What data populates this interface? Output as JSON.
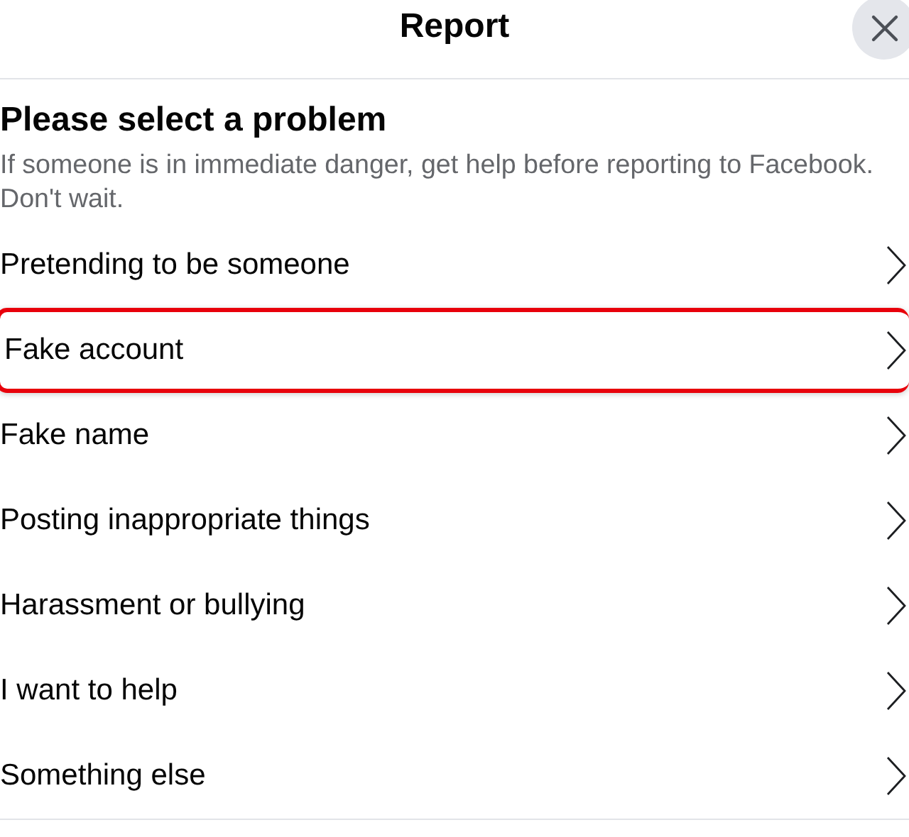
{
  "header": {
    "title": "Report"
  },
  "heading": "Please select a problem",
  "description": "If someone is in immediate danger, get help before reporting to Facebook. Don't wait.",
  "options": [
    {
      "label": "Pretending to be someone",
      "highlighted": false
    },
    {
      "label": "Fake account",
      "highlighted": true
    },
    {
      "label": "Fake name",
      "highlighted": false
    },
    {
      "label": "Posting inappropriate things",
      "highlighted": false
    },
    {
      "label": "Harassment or bullying",
      "highlighted": false
    },
    {
      "label": "I want to help",
      "highlighted": false
    },
    {
      "label": "Something else",
      "highlighted": false
    }
  ]
}
